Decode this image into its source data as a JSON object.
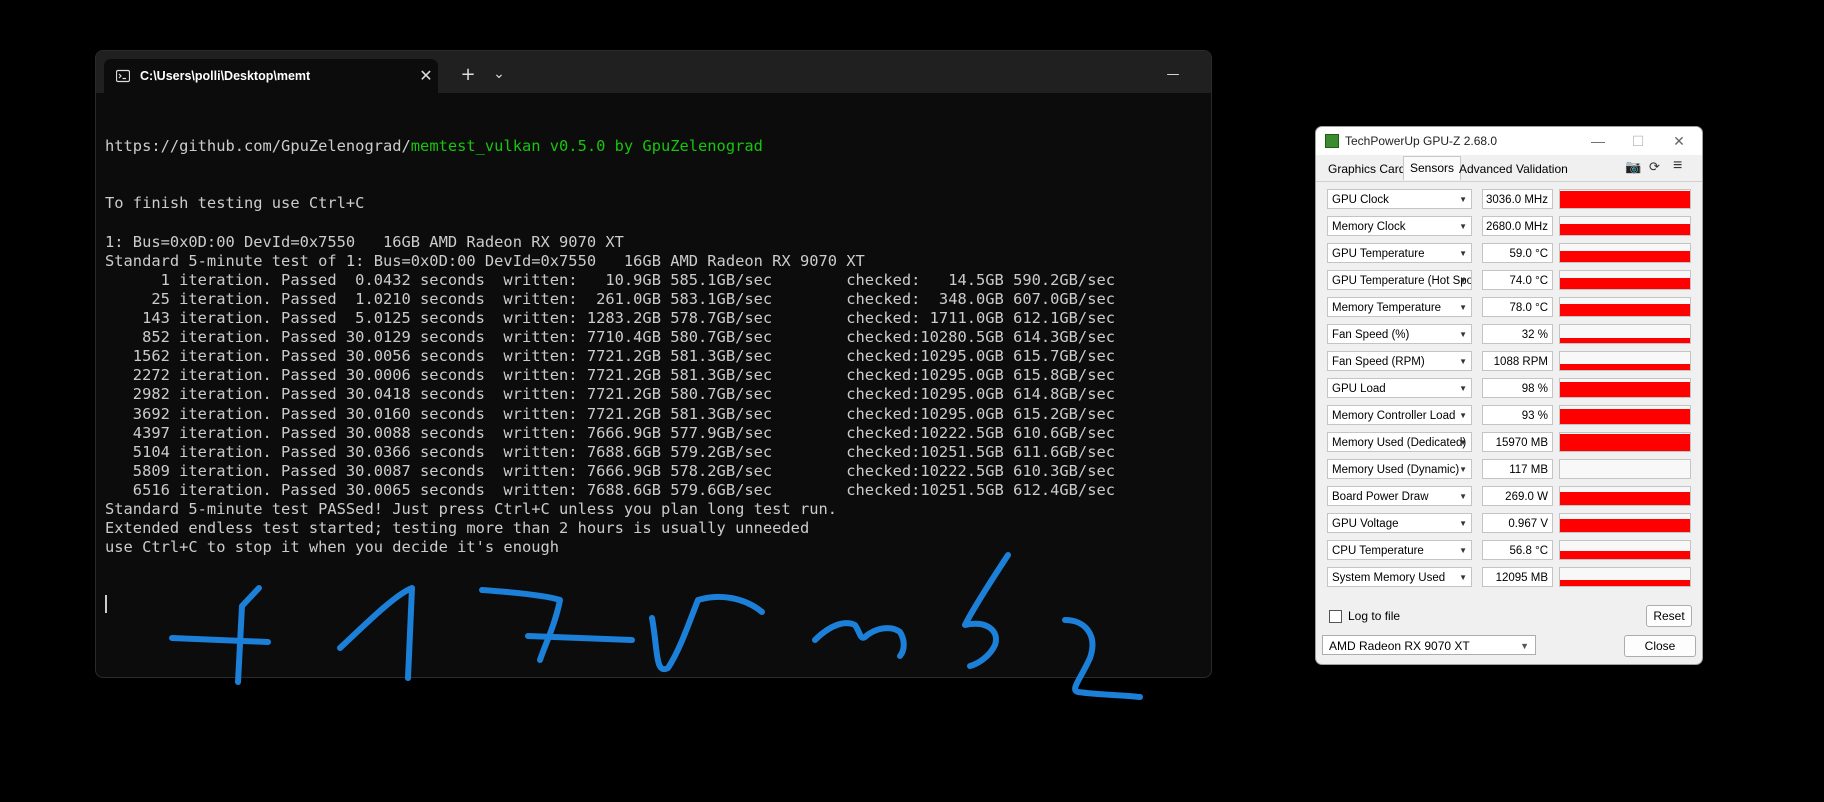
{
  "terminal": {
    "tab_title": "C:\\Users\\polli\\Desktop\\memt",
    "tab_close_icon": "✕",
    "new_tab_icon": "+",
    "tab_dropdown_icon": "⌄",
    "minimize_icon": "—",
    "maximize_icon": "☐",
    "close_icon": "✕",
    "url_prefix": "https://github.com/GpuZelenograd/",
    "url_suffix": "memtest_vulkan v0.5.0 by GpuZelenograd",
    "lines": [
      "To finish testing use Ctrl+C",
      "",
      "1: Bus=0x0D:00 DevId=0x7550   16GB AMD Radeon RX 9070 XT",
      "Standard 5-minute test of 1: Bus=0x0D:00 DevId=0x7550   16GB AMD Radeon RX 9070 XT",
      "      1 iteration. Passed  0.0432 seconds  written:   10.9GB 585.1GB/sec        checked:   14.5GB 590.2GB/sec",
      "     25 iteration. Passed  1.0210 seconds  written:  261.0GB 583.1GB/sec        checked:  348.0GB 607.0GB/sec",
      "    143 iteration. Passed  5.0125 seconds  written: 1283.2GB 578.7GB/sec        checked: 1711.0GB 612.1GB/sec",
      "    852 iteration. Passed 30.0129 seconds  written: 7710.4GB 580.7GB/sec        checked:10280.5GB 614.3GB/sec",
      "   1562 iteration. Passed 30.0056 seconds  written: 7721.2GB 581.3GB/sec        checked:10295.0GB 615.7GB/sec",
      "   2272 iteration. Passed 30.0006 seconds  written: 7721.2GB 581.3GB/sec        checked:10295.0GB 615.8GB/sec",
      "   2982 iteration. Passed 30.0418 seconds  written: 7721.2GB 580.7GB/sec        checked:10295.0GB 614.8GB/sec",
      "   3692 iteration. Passed 30.0160 seconds  written: 7721.2GB 581.3GB/sec        checked:10295.0GB 615.2GB/sec",
      "   4397 iteration. Passed 30.0088 seconds  written: 7666.9GB 577.9GB/sec        checked:10222.5GB 610.6GB/sec",
      "   5104 iteration. Passed 30.0366 seconds  written: 7688.6GB 579.2GB/sec        checked:10251.5GB 611.6GB/sec",
      "   5809 iteration. Passed 30.0087 seconds  written: 7666.9GB 578.2GB/sec        checked:10222.5GB 610.3GB/sec",
      "   6516 iteration. Passed 30.0065 seconds  written: 7688.6GB 579.6GB/sec        checked:10251.5GB 612.4GB/sec",
      "Standard 5-minute test PASSed! Just press Ctrl+C unless you plan long test run.",
      "Extended endless test started; testing more than 2 hours is usually unneeded",
      "use Ctrl+C to stop it when you decide it's enough"
    ]
  },
  "gpuz": {
    "title": "TechPowerUp GPU-Z 2.68.0",
    "minimize_icon": "—",
    "maximize_icon": "☐",
    "close_icon": "✕",
    "tabs": [
      "Graphics Card",
      "Sensors",
      "Advanced",
      "Validation"
    ],
    "active_tab": "Sensors",
    "camera_icon": "📷",
    "refresh_icon": "⟳",
    "menu_icon": "≡",
    "sensors": [
      {
        "name": "GPU Clock",
        "value": "3036.0 MHz",
        "level": 0.95
      },
      {
        "name": "Memory Clock",
        "value": "2680.0 MHz",
        "level": 0.6
      },
      {
        "name": "GPU Temperature",
        "value": "59.0 °C",
        "level": 0.6
      },
      {
        "name": "GPU Temperature (Hot Spot)",
        "value": "74.0 °C",
        "level": 0.6
      },
      {
        "name": "Memory Temperature",
        "value": "78.0 °C",
        "level": 0.65
      },
      {
        "name": "Fan Speed (%)",
        "value": "32 %",
        "level": 0.3
      },
      {
        "name": "Fan Speed (RPM)",
        "value": "1088 RPM",
        "level": 0.35
      },
      {
        "name": "GPU Load",
        "value": "98 %",
        "level": 0.85
      },
      {
        "name": "Memory Controller Load",
        "value": "93 %",
        "level": 0.85
      },
      {
        "name": "Memory Used (Dedicated)",
        "value": "15970 MB",
        "level": 0.95
      },
      {
        "name": "Memory Used (Dynamic)",
        "value": "117 MB",
        "level": 0.0
      },
      {
        "name": "Board Power Draw",
        "value": "269.0 W",
        "level": 0.7
      },
      {
        "name": "GPU Voltage",
        "value": "0.967 V",
        "level": 0.75
      },
      {
        "name": "CPU Temperature",
        "value": "56.8 °C",
        "level": 0.45
      },
      {
        "name": "System Memory Used",
        "value": "12095 MB",
        "level": 0.35
      }
    ],
    "dropdown_icon": "▼",
    "log_label": "Log to file",
    "reset_label": "Reset",
    "gpu_select": "AMD Radeon RX 9070 XT",
    "close_label": "Close",
    "graph_color": "#ff0000"
  },
  "ink_color": "#1c7fd8"
}
